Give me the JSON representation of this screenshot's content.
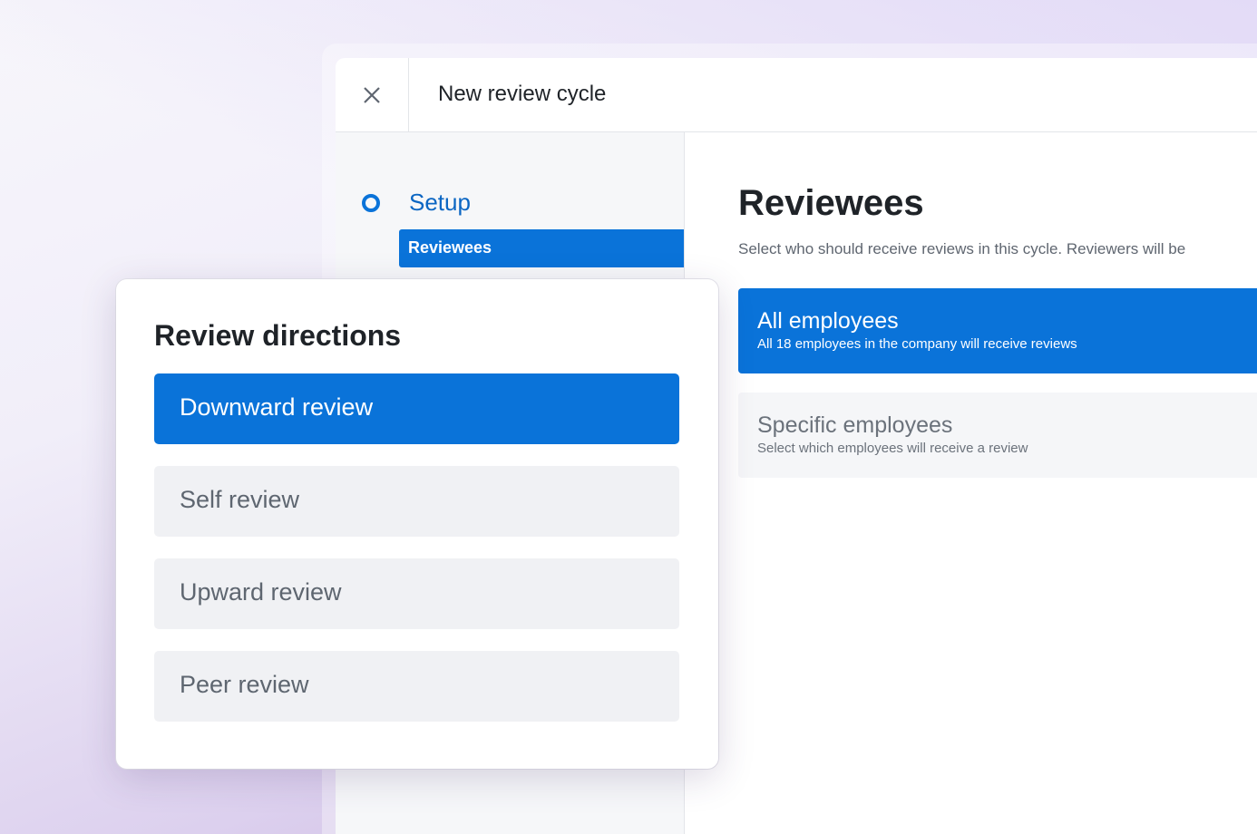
{
  "window": {
    "title": "New review cycle",
    "close_icon": "close-icon"
  },
  "sidebar": {
    "section": "Setup",
    "active_item": "Reviewees"
  },
  "main": {
    "heading": "Reviewees",
    "description": "Select who should receive reviews in this cycle. Reviewers will be",
    "options": [
      {
        "title": "All employees",
        "subtitle": "All 18 employees in the company will receive reviews",
        "selected": true
      },
      {
        "title": "Specific employees",
        "subtitle": "Select which employees will receive a review",
        "selected": false
      }
    ]
  },
  "directions": {
    "heading": "Review directions",
    "items": [
      {
        "label": "Downward review",
        "selected": true
      },
      {
        "label": "Self review",
        "selected": false
      },
      {
        "label": "Upward review",
        "selected": false
      },
      {
        "label": "Peer review",
        "selected": false
      }
    ]
  },
  "colors": {
    "accent": "#0a73d9"
  }
}
